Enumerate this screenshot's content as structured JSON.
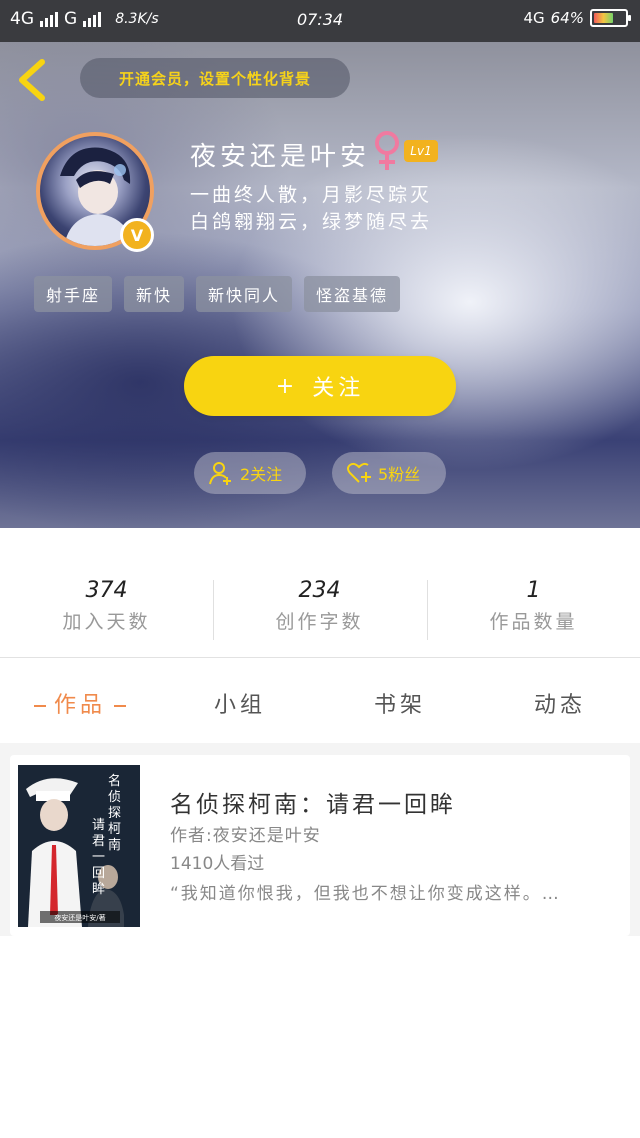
{
  "status_bar": {
    "network_1": "4G",
    "network_2": "G",
    "speed": "8.3K/s",
    "time": "07:34",
    "network_right": "4G",
    "battery": "64%",
    "battery_level": 0.64
  },
  "header": {
    "vip_banner": "开通会员，设置个性化背景",
    "name": "夜安还是叶安",
    "level": "Lv1",
    "vip_badge": "V",
    "bio_line1": "一曲终人散，月影尽踪灭",
    "bio_line2": "白鸽翱翔云，绿梦随尽去",
    "tags": [
      "射手座",
      "新快",
      "新快同人",
      "怪盗基德"
    ],
    "follow_plus": "+",
    "follow_label": "关注",
    "following": "2关注",
    "fans": "5粉丝",
    "icons": {
      "back": "chevron-left-icon",
      "gender": "female-icon",
      "following": "user-add-icon",
      "fans": "heart-add-icon"
    }
  },
  "stats": [
    {
      "value": "374",
      "label": "加入天数"
    },
    {
      "value": "234",
      "label": "创作字数"
    },
    {
      "value": "1",
      "label": "作品数量"
    }
  ],
  "tabs": [
    "作品",
    "小组",
    "书架",
    "动态"
  ],
  "works": [
    {
      "title": "名侦探柯南：请君一回眸",
      "author": "作者:夜安还是叶安",
      "views": "1410人看过",
      "excerpt": "“我知道你恨我，但我也不想让你变成这样。…",
      "cover_text": "名侦探柯南 请君一回眸",
      "cover_author": "夜安还是叶安/著"
    }
  ],
  "colors": {
    "accent_yellow": "#f8d411",
    "tab_active": "#f08a4b",
    "status_bar_bg": "#3a3b3f"
  }
}
